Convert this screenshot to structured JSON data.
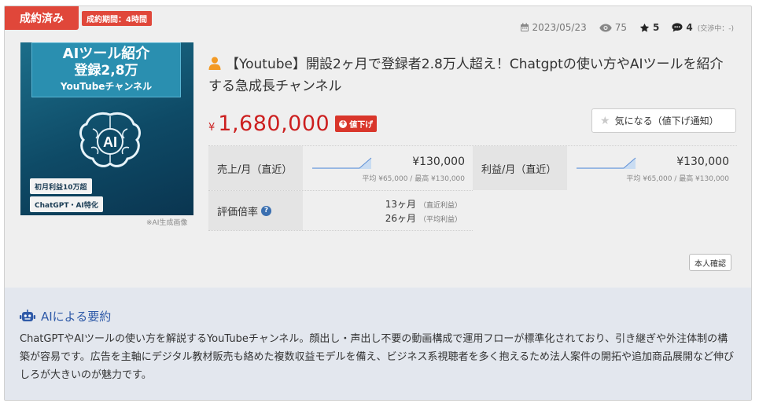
{
  "badges": {
    "sold": "成約済み",
    "period": "成約期間：4時間"
  },
  "meta": {
    "date": "2023/05/23",
    "views": "75",
    "stars": "5",
    "comments": "4",
    "comment_note": "(交渉中：-)"
  },
  "thumbnail": {
    "line1": "AIツール紹介",
    "line2": "登録2,8万",
    "line3": "YouTubeチャンネル",
    "center": "AI",
    "pill1": "初月利益10万超",
    "pill2": "ChatGPT・AI特化",
    "caption": "※AI生成画像"
  },
  "listing": {
    "title": "【Youtube】開設2ヶ月で登録者2.8万人超え！Chatgptの使い方やAIツールを紹介する急成長チャンネル",
    "price_symbol": "¥",
    "price": "1,680,000",
    "price_drop_label": "値下げ",
    "fav_label": "気になる（値下げ通知）"
  },
  "metrics": {
    "sales_label": "売上/月（直近）",
    "sales_value": "¥130,000",
    "sales_sub": "平均 ¥65,000 / 最高 ¥130,000",
    "profit_label": "利益/月（直近）",
    "profit_value": "¥130,000",
    "profit_sub": "平均 ¥65,000 / 最高 ¥130,000",
    "multiple_label": "評価倍率",
    "multiple_recent": "13ヶ月",
    "multiple_recent_note": "（直近利益）",
    "multiple_avg": "26ヶ月",
    "multiple_avg_note": "（平均利益）"
  },
  "verify_label": "本人確認",
  "summary": {
    "heading": "AIによる要約",
    "text": "ChatGPTやAIツールの使い方を解説するYouTubeチャンネル。顔出し・声出し不要の動画構成で運用フローが標準化されており、引き継ぎや外注体制の構築が容易です。広告を主軸にデジタル教材販売も絡めた複数収益モデルを備え、ビジネス系視聴者を多く抱えるため法人案件の開拓や追加商品展開など伸びしろが大きいのが魅力です。"
  },
  "colors": {
    "accent_red": "#e0473a",
    "price_red": "#cc1f1f",
    "summary_blue": "#2f5aa8"
  }
}
